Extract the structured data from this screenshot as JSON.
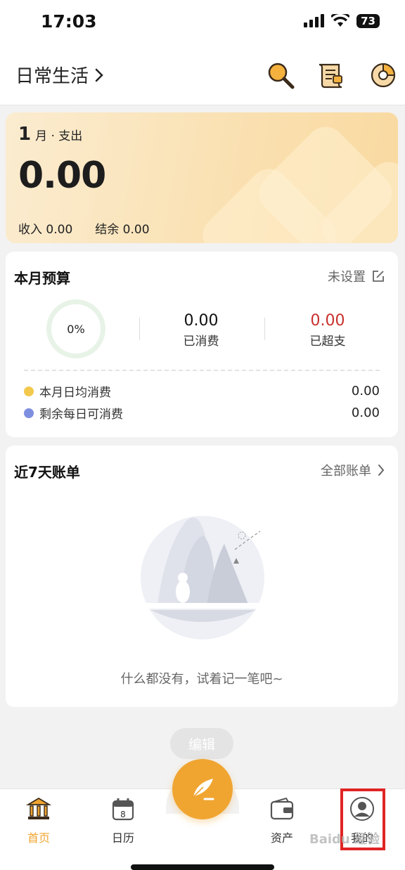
{
  "status": {
    "time": "17:03",
    "battery": "73"
  },
  "header": {
    "book_title": "日常生活",
    "icons": [
      "search-icon",
      "bill-scroll-icon",
      "pie-chart-icon"
    ]
  },
  "summary": {
    "month_num": "1",
    "month_label": "月 · 支出",
    "expense": "0.00",
    "income_label": "收入",
    "income": "0.00",
    "balance_label": "结余",
    "balance": "0.00"
  },
  "budget": {
    "title": "本月预算",
    "status_text": "未设置",
    "percent": "0%",
    "spent_value": "0.00",
    "spent_label": "已消费",
    "over_value": "0.00",
    "over_label": "已超支",
    "daily_avg_label": "本月日均消费",
    "daily_avg_value": "0.00",
    "daily_remaining_label": "剩余每日可消费",
    "daily_remaining_value": "0.00",
    "colors": {
      "accent_yellow": "#f2c94c",
      "accent_blue": "#7f8fe0",
      "over_red": "#c9302c"
    }
  },
  "recent": {
    "title": "近7天账单",
    "all_link": "全部账单",
    "empty_text": "什么都没有，试着记一笔吧~"
  },
  "edit_pill": "编辑",
  "tabs": [
    {
      "label": "首页",
      "icon": "bank-icon",
      "active": true
    },
    {
      "label": "日历",
      "icon": "calendar-icon",
      "active": false
    },
    {
      "label": "资产",
      "icon": "wallet-icon",
      "active": false
    },
    {
      "label": "我的",
      "icon": "person-icon",
      "active": false
    }
  ],
  "watermark": "Baidu 经验",
  "brand_color": "#f0a531"
}
